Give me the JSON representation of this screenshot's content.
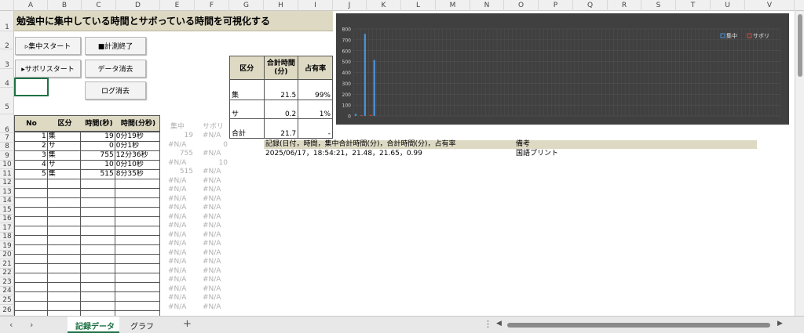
{
  "title": "勉強中に集中している時間とサボっている時間を可視化する",
  "columns": [
    "A",
    "B",
    "C",
    "D",
    "E",
    "F",
    "G",
    "H",
    "I",
    "J",
    "K",
    "L",
    "M",
    "N",
    "O",
    "P",
    "Q",
    "R",
    "S",
    "T",
    "U",
    "V"
  ],
  "rows": [
    "1",
    "2",
    "3",
    "4",
    "5",
    "6",
    "7",
    "8",
    "9",
    "10",
    "11",
    "12",
    "13",
    "14",
    "15",
    "16",
    "17",
    "18",
    "19",
    "20",
    "21",
    "22",
    "23",
    "24",
    "25",
    "26"
  ],
  "buttons": {
    "focus_start": "▹集中スタート",
    "stop": "■計測終了",
    "slack_start": "▸サボリスタート",
    "clear_data": "データ消去",
    "clear_log": "ログ消去"
  },
  "summary": {
    "headers": [
      "区分",
      "合計時間\n(分)",
      "占有率"
    ],
    "rows": [
      {
        "kind": "集",
        "minutes": "21.5",
        "rate": "99%"
      },
      {
        "kind": "サ",
        "minutes": "0.2",
        "rate": "1%"
      },
      {
        "kind": "合計",
        "minutes": "21.7",
        "rate": "-"
      }
    ]
  },
  "table": {
    "headers": [
      "No",
      "区分",
      "時間(秒)",
      "時間(分秒)"
    ],
    "rows": [
      {
        "no": "1",
        "kind": "集",
        "sec": "19",
        "ms": "0分19秒"
      },
      {
        "no": "2",
        "kind": "サ",
        "sec": "0",
        "ms": "0分1秒"
      },
      {
        "no": "3",
        "kind": "集",
        "sec": "755",
        "ms": "12分36秒"
      },
      {
        "no": "4",
        "kind": "サ",
        "sec": "10",
        "ms": "0分10秒"
      },
      {
        "no": "5",
        "kind": "集",
        "sec": "515",
        "ms": "8分35秒"
      }
    ]
  },
  "helper": {
    "headers": [
      "集中",
      "サボリ"
    ],
    "rows": [
      [
        "19",
        "#N/A"
      ],
      [
        "#N/A",
        "0"
      ],
      [
        "755",
        "#N/A"
      ],
      [
        "#N/A",
        "10"
      ],
      [
        "515",
        "#N/A"
      ],
      [
        "#N/A",
        "#N/A"
      ],
      [
        "#N/A",
        "#N/A"
      ],
      [
        "#N/A",
        "#N/A"
      ],
      [
        "#N/A",
        "#N/A"
      ],
      [
        "#N/A",
        "#N/A"
      ],
      [
        "#N/A",
        "#N/A"
      ],
      [
        "#N/A",
        "#N/A"
      ],
      [
        "#N/A",
        "#N/A"
      ],
      [
        "#N/A",
        "#N/A"
      ],
      [
        "#N/A",
        "#N/A"
      ],
      [
        "#N/A",
        "#N/A"
      ],
      [
        "#N/A",
        "#N/A"
      ],
      [
        "#N/A",
        "#N/A"
      ],
      [
        "#N/A",
        "#N/A"
      ],
      [
        "#N/A",
        "#N/A"
      ]
    ]
  },
  "log": {
    "header": "記録(日付，時間，集中合計時間(分)，合計時間(分)，占有率",
    "note_header": "備考",
    "entry": "2025/06/17，18:54:21，21.48，21.65，0.99",
    "note": "国語プリント"
  },
  "chart_data": {
    "type": "bar",
    "x": [
      1,
      2,
      3,
      4,
      5
    ],
    "series": [
      {
        "name": "集中",
        "values": [
          19,
          null,
          755,
          null,
          515
        ],
        "color": "#4a8fd6"
      },
      {
        "name": "サボリ",
        "values": [
          null,
          0,
          null,
          10,
          null
        ],
        "color": "#d24a3a"
      }
    ],
    "yticks": [
      "0",
      "100",
      "200",
      "300",
      "400",
      "500",
      "600",
      "700",
      "800"
    ],
    "ylim": [
      0,
      800
    ],
    "legend": "top-right"
  },
  "tabs": [
    "記録データ",
    "グラフ"
  ],
  "add_tab": "+",
  "colors": {
    "header_fill": "#ddd9c3",
    "chart_bg": "#404040",
    "tab_active": "#1e7145"
  }
}
